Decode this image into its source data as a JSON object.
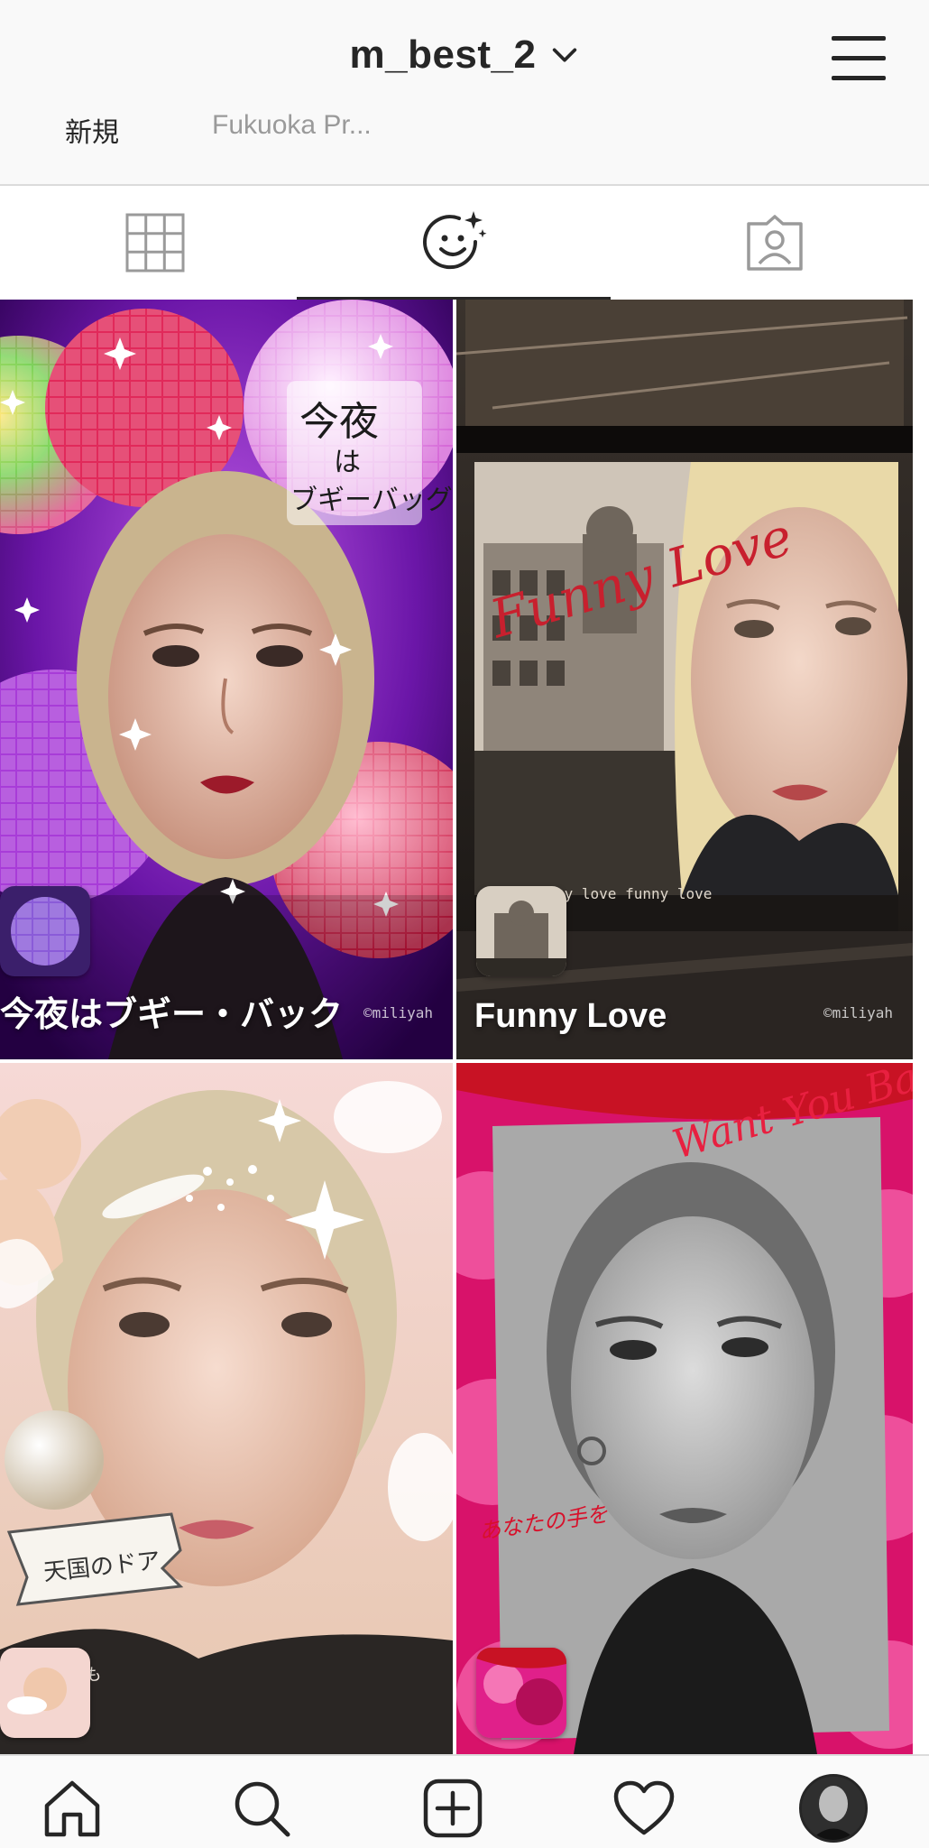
{
  "header": {
    "username": "m_best_2",
    "icons": {
      "dropdown": "chevron-down-icon",
      "menu": "hamburger-menu-icon"
    }
  },
  "highlights": [
    {
      "label": "新規"
    },
    {
      "label": "Fukuoka Pr..."
    }
  ],
  "tabs": [
    {
      "name": "grid",
      "icon": "grid-icon",
      "active": false
    },
    {
      "name": "effects",
      "icon": "face-sparkle-icon",
      "active": true
    },
    {
      "name": "tagged",
      "icon": "tagged-person-icon",
      "active": false
    }
  ],
  "effects": [
    {
      "title": "今夜はブギー・バック",
      "credit": "©miliyah",
      "theme": "disco"
    },
    {
      "title": "Funny Love",
      "credit": "©miliyah",
      "theme": "film"
    },
    {
      "title": "",
      "credit": "",
      "theme": "angel"
    },
    {
      "title": "",
      "credit": "",
      "theme": "roses"
    }
  ],
  "bottom_nav": {
    "items": [
      {
        "name": "home",
        "icon": "home-icon"
      },
      {
        "name": "search",
        "icon": "search-icon"
      },
      {
        "name": "create",
        "icon": "plus-square-icon"
      },
      {
        "name": "activity",
        "icon": "heart-icon"
      },
      {
        "name": "profile",
        "icon": "avatar"
      }
    ]
  },
  "colors": {
    "text": "#262626",
    "muted": "#9a9a9a",
    "divider": "#dbdbdb",
    "header_bg": "#f9f9f9"
  }
}
